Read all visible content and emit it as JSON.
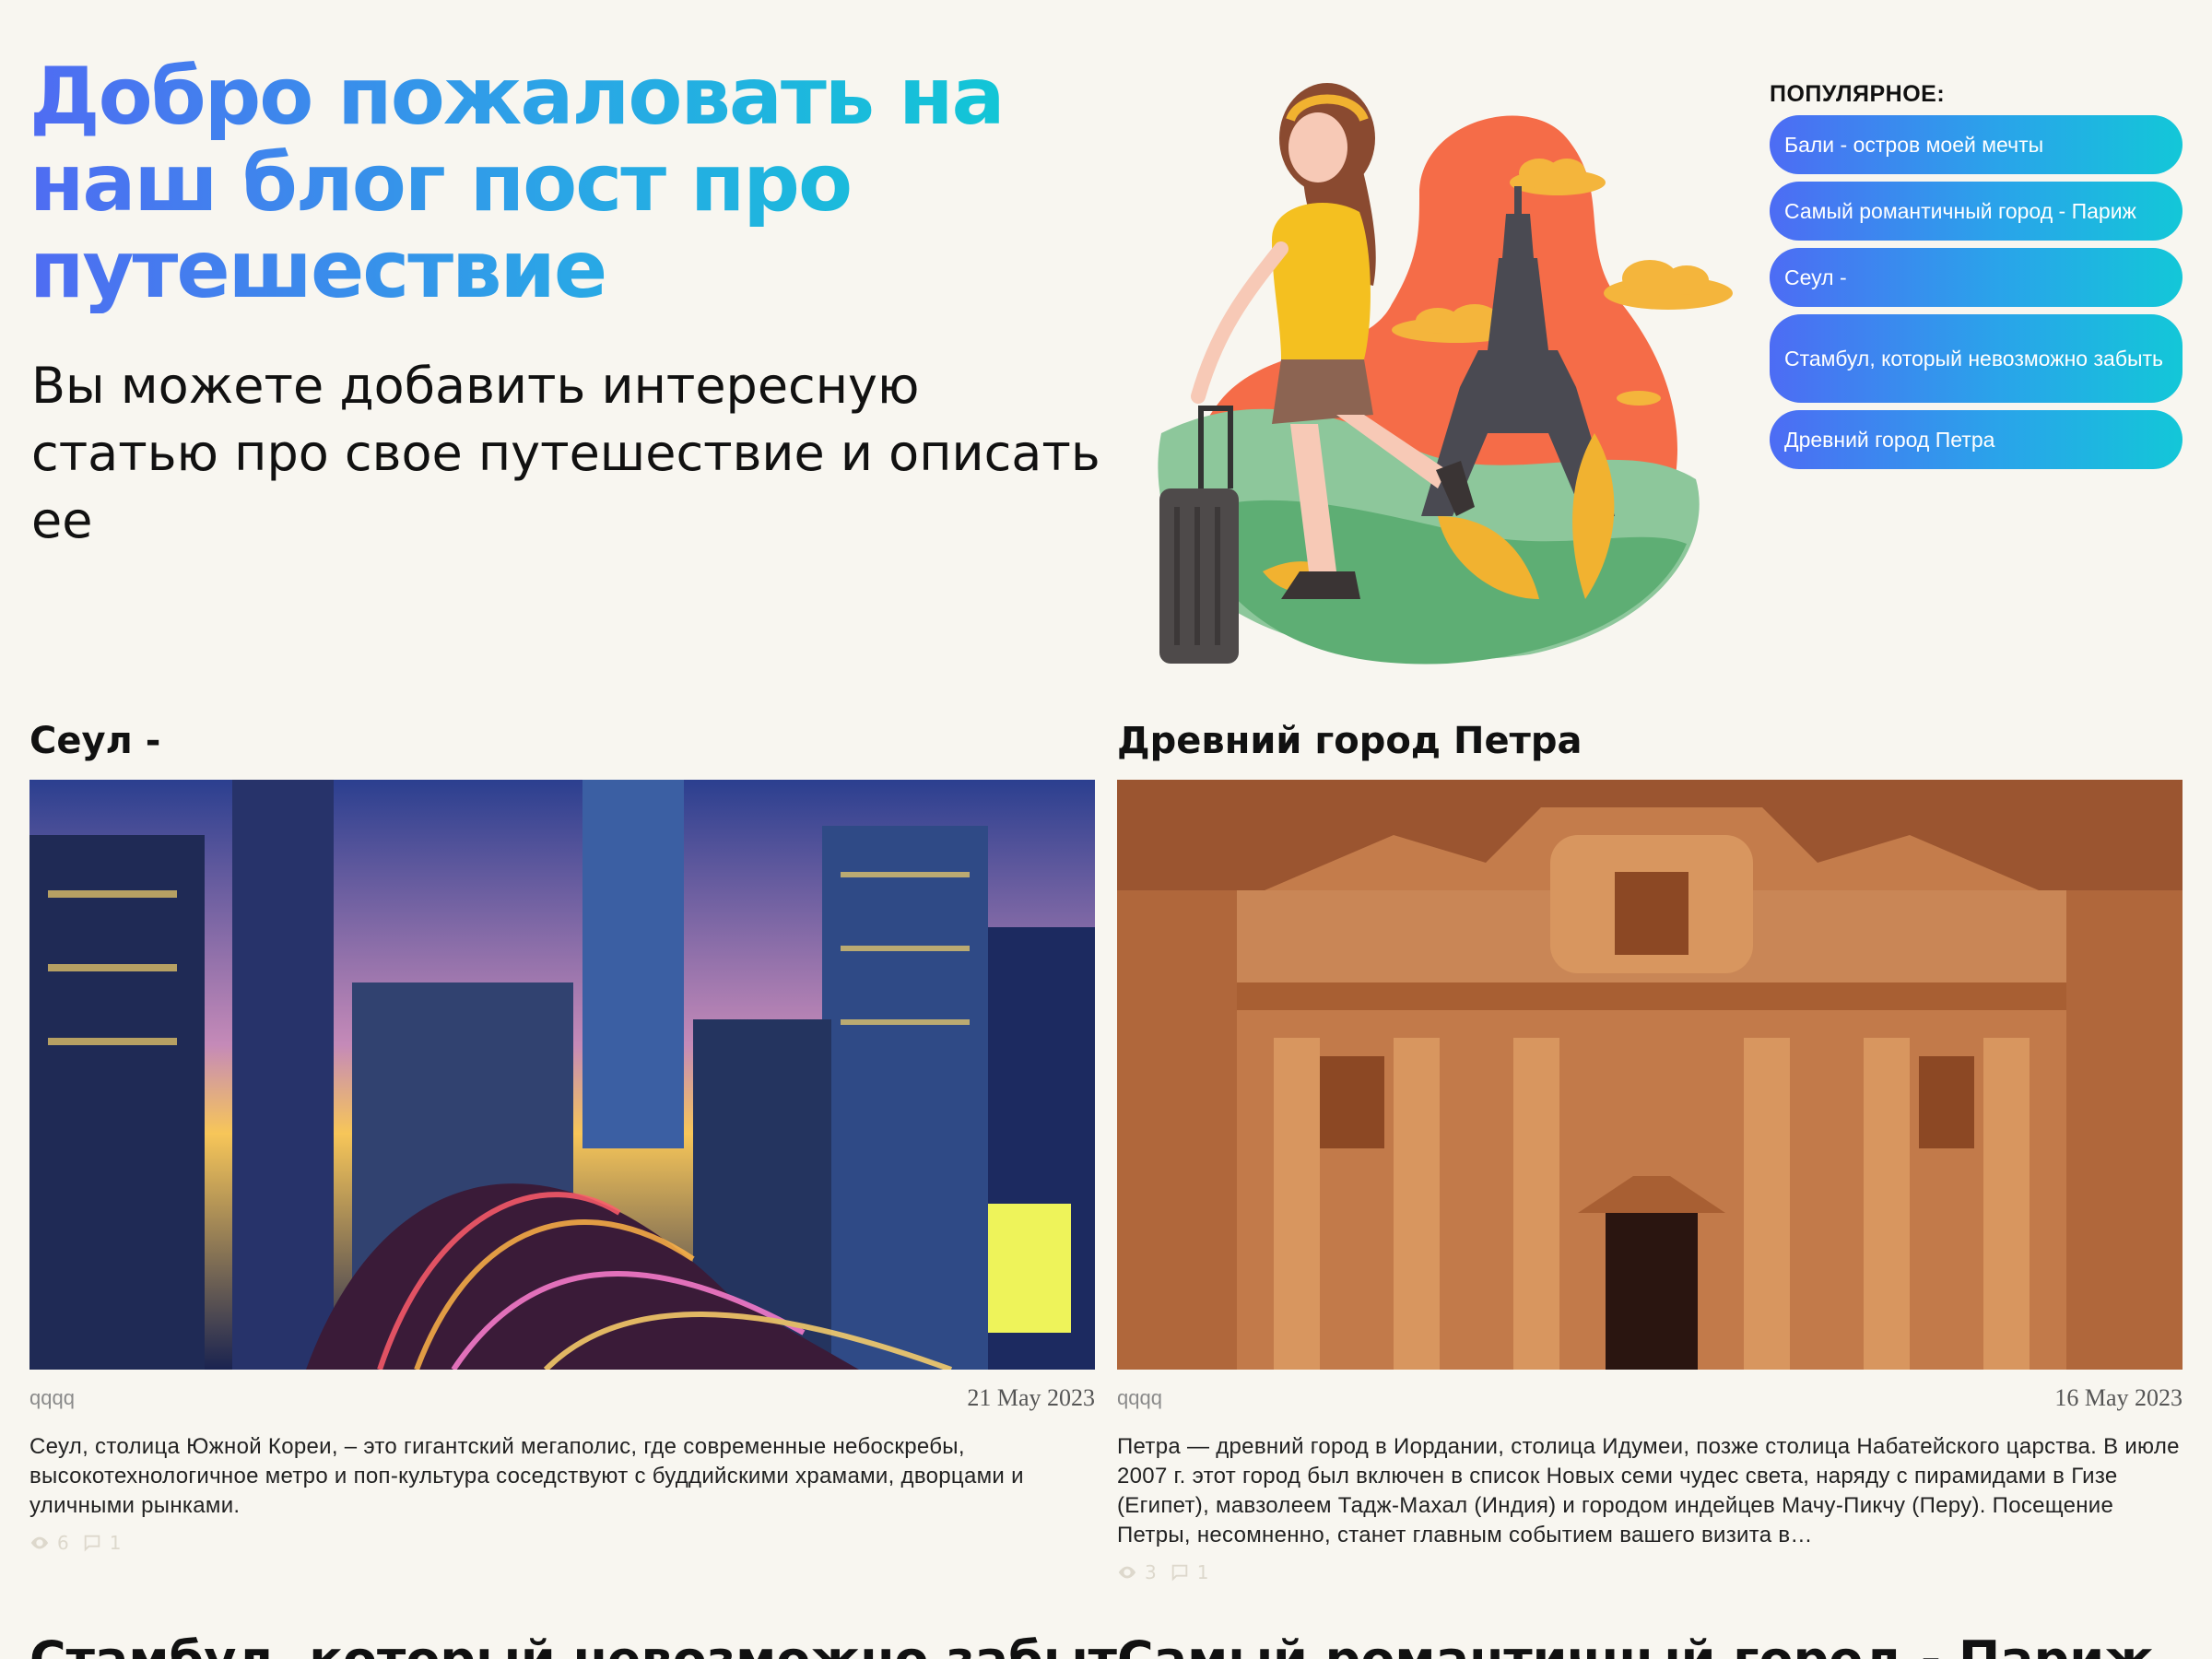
{
  "hero": {
    "title": "Добро пожаловать на наш блог пост про путешествие",
    "subtitle": "Вы можете добавить интересную статью про свое путешествие и описать ее"
  },
  "popular": {
    "heading": "ПОПУЛЯРНОЕ:",
    "items": [
      "Бали - остров моей мечты",
      "Самый романтичный город - Париж",
      "Сеул -",
      "Стамбул, который невозможно забыть",
      "Древний город Петра"
    ]
  },
  "posts": [
    {
      "title": "Сеул -",
      "author": "qqqq",
      "date": "21 May 2023",
      "excerpt": "Сеул, столица Южной Кореи, – это гигантский мегаполис, где современные небоскребы, высокотехнологичное метро и поп-культура соседствуют с буддийскими храмами, дворцами и уличными рынками.",
      "views": "6",
      "comments": "1"
    },
    {
      "title": "Древний город Петра",
      "author": "qqqq",
      "date": "16 May 2023",
      "excerpt": "Петра — древний город в Иордании, столица Идумеи, позже столица Набатейского царства. В июле 2007 г. этот город был включен в список Новых семи чудес света, наряду с пирамидами в Гизе (Египет), мавзолеем Тадж-Махал (Индия) и городом индейцев Мачу-Пикчу (Перу). Посещение Петры, несомненно, станет главным событием вашего визита в…",
      "views": "3",
      "comments": "1"
    }
  ],
  "next_posts": [
    "Стамбул, который невозможно забыть",
    "Самый романтичный город - Париж"
  ],
  "colors": {
    "background": "#f8f6f0",
    "gradient_start": "#4d6cf4",
    "gradient_end": "#13c7d8"
  }
}
